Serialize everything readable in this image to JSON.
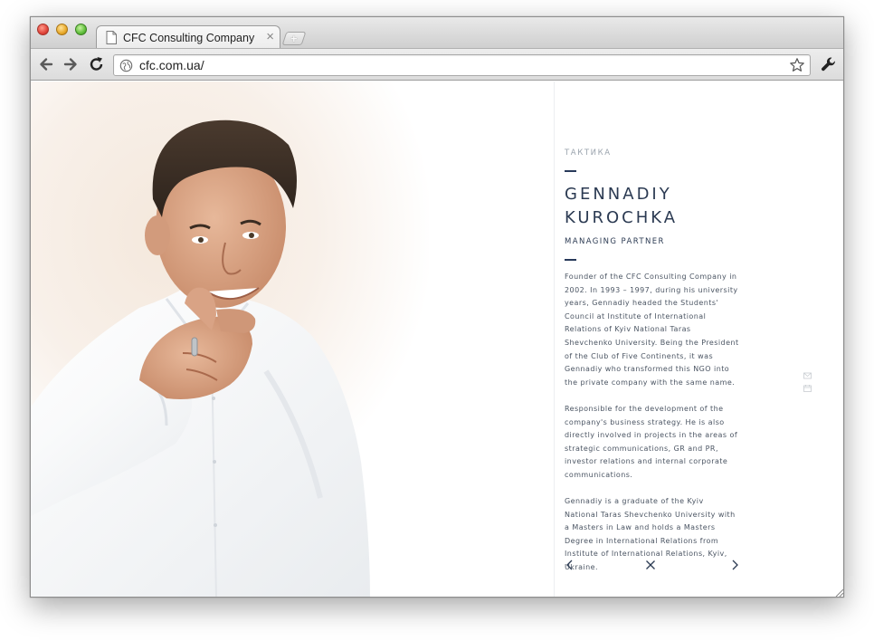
{
  "browser": {
    "tab_title": "CFC Consulting Company",
    "tab_close": "×",
    "new_tab": "+",
    "url": "cfc.com.ua/"
  },
  "icons": {
    "close": "close-traffic-light",
    "minimize": "minimize-traffic-light",
    "maximize": "maximize-traffic-light",
    "tab_doc": "document-icon",
    "back": "back-arrow-icon",
    "forward": "forward-arrow-icon",
    "reload": "reload-icon",
    "globe": "globe-icon",
    "star": "star-icon",
    "wrench": "wrench-icon"
  },
  "profile": {
    "eyebrow": "ТАКТИКА",
    "name_line1": "GENNADIY",
    "name_line2": "KUROCHKA",
    "role": "MANAGING PARTNER",
    "bio": [
      "Founder of the CFC Consulting Company in 2002. In 1993 – 1997, during his university years, Gennadiy headed the Students' Council at Institute of International Relations of Kyiv National Taras Shevchenko University. Being the President of the Club of Five Continents, it was Gennadiy who transformed this NGO into the private company with the same name.",
      "Responsible for the development of the company's business strategy. He is also directly involved in projects in the areas of strategic communications, GR and PR, investor relations and internal corporate communications.",
      "Gennadiy is a graduate of the Kyiv National Taras Shevchenko University with a Masters in Law and holds a Masters Degree in International Relations from Institute of International Relations, Kyiv, Ukraine."
    ]
  },
  "colors": {
    "accent": "#283a5a",
    "text": "#4b5563",
    "muted": "#9aa3ad"
  }
}
